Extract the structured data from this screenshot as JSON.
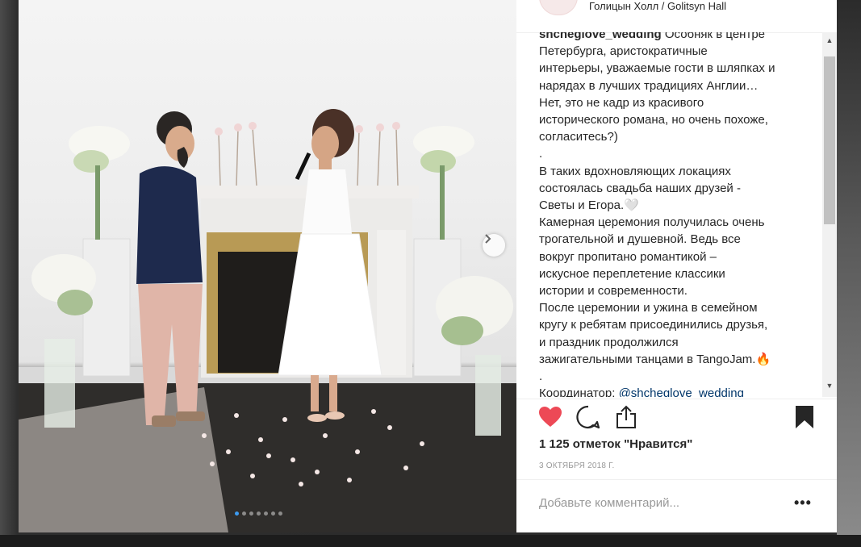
{
  "post": {
    "location": "Голицын Холл / Golitsyn Hall",
    "caption": {
      "username": "shcheglove_wedding",
      "first_line_rest": " Особняк в центре",
      "lines": [
        "Петербурга, аристократичные",
        "интерьеры, уважаемые гости в шляпках и",
        "нарядах в лучших традициях Англии…",
        "Нет, это не кадр из красивого",
        "исторического романа, но очень похоже,",
        "согласитесь?)",
        ".",
        "В таких вдохновляющих локациях",
        "состоялась свадьба наших друзей -",
        "Светы и Егора.🤍",
        "Камерная церемония получилась очень",
        "трогательной и душевной. Ведь все",
        "вокруг пропитано романтикой –",
        "искусное переплетение классики",
        "истории и современности.",
        "После церемонии и ужина в семейном",
        "кругу к ребятам присоединились друзья,",
        "и праздник продолжился",
        "зажигательными танцами в TangoJam.🔥",
        "."
      ],
      "coordinator_label": "Координатор: ",
      "coordinator_mention": "@shcheglove_wedding"
    },
    "likes_text": "1 125 отметок \"Нравится\"",
    "date_text": "3 ОКТЯБРЯ 2018 Г.",
    "comment_placeholder": "Добавьте комментарий...",
    "more_label": "•••"
  },
  "carousel": {
    "slides": 7,
    "active_index": 0
  },
  "colors": {
    "heart": "#ed4956",
    "text": "#262626",
    "muted": "#999999",
    "dot_active": "#3d9bf0",
    "mention": "#003569"
  },
  "icons": [
    "heart-icon",
    "comment-icon",
    "share-icon",
    "bookmark-icon",
    "chevron-right-icon"
  ]
}
